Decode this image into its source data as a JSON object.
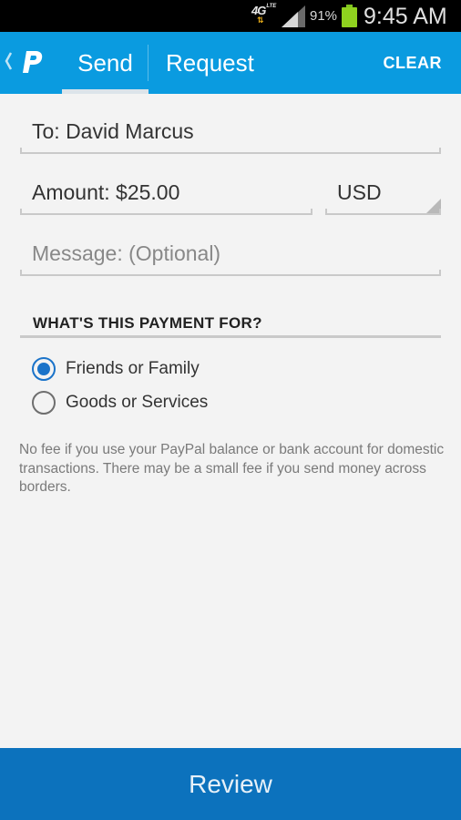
{
  "status_bar": {
    "network": "4G",
    "network_sub": "LTE",
    "battery_percent": "91%",
    "time": "9:45 AM",
    "battery_color": "#8fd21f"
  },
  "app_bar": {
    "tabs": [
      {
        "label": "Send",
        "selected": true
      },
      {
        "label": "Request",
        "selected": false
      }
    ],
    "clear_label": "CLEAR",
    "accent_color": "#0a9be0"
  },
  "form": {
    "to": "To: David Marcus",
    "amount": "Amount: $25.00",
    "currency": "USD",
    "message_placeholder": "Message: (Optional)"
  },
  "payment_purpose": {
    "heading": "WHAT'S THIS PAYMENT FOR?",
    "options": [
      {
        "label": "Friends or Family",
        "selected": true
      },
      {
        "label": "Goods or Services",
        "selected": false
      }
    ]
  },
  "fee_note": "No fee if you use your PayPal balance or bank account for domestic transactions. There may be a small fee if you send money across borders.",
  "review_label": "Review"
}
